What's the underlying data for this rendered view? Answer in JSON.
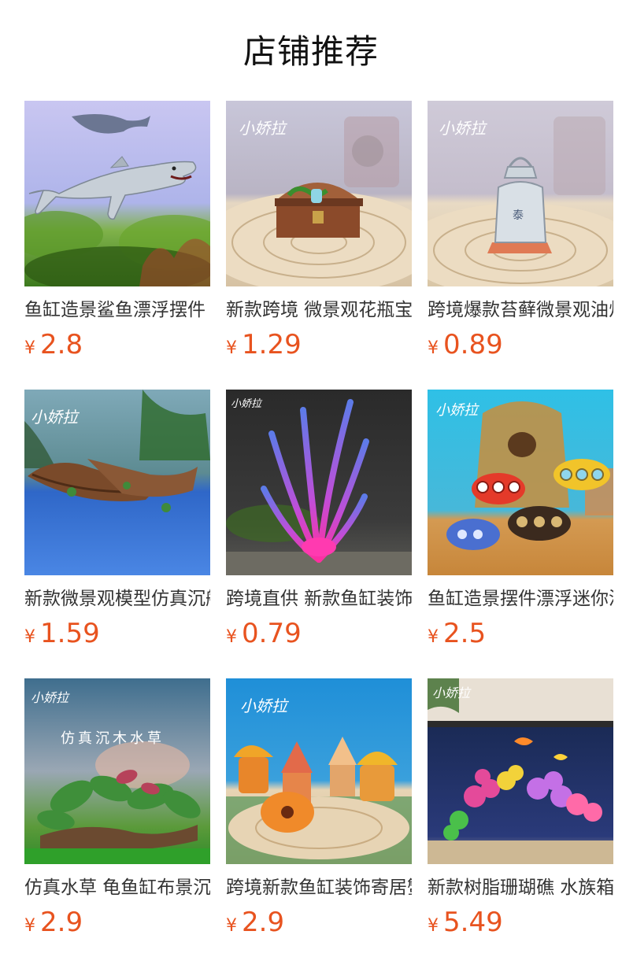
{
  "page": {
    "title": "店铺推荐"
  },
  "products": [
    {
      "name": "鱼缸造景鲨鱼漂浮摆件",
      "currency": "¥",
      "price": "2.8",
      "image_icon": "shark-figurine-image"
    },
    {
      "name": "新款跨境 微景观花瓶宝箱",
      "currency": "¥",
      "price": "1.29",
      "image_icon": "treasure-chest-image",
      "watermark": "小娇拉"
    },
    {
      "name": "跨境爆款苔藓微景观油灯",
      "currency": "¥",
      "price": "0.89",
      "image_icon": "lantern-image",
      "watermark": "小娇拉"
    },
    {
      "name": "新款微景观模型仿真沉船",
      "currency": "¥",
      "price": "1.59",
      "image_icon": "shipwreck-image",
      "watermark": "小娇拉"
    },
    {
      "name": "跨境直供 新款鱼缸装饰水草",
      "currency": "¥",
      "price": "0.79",
      "image_icon": "seaweed-plant-image",
      "watermark": "小娇拉"
    },
    {
      "name": "鱼缸造景摆件漂浮迷你潜艇",
      "currency": "¥",
      "price": "2.5",
      "image_icon": "submarine-image",
      "watermark": "小娇拉"
    },
    {
      "name": "仿真水草 龟鱼缸布景沉木",
      "currency": "¥",
      "price": "2.9",
      "image_icon": "driftwood-plant-image",
      "watermark": "小娇拉",
      "overlay_text": "仿真沉木水草"
    },
    {
      "name": "跨境新款鱼缸装饰寄居蟹屋",
      "currency": "¥",
      "price": "2.9",
      "image_icon": "mushroom-houses-image",
      "watermark": "小娇拉"
    },
    {
      "name": "新款树脂珊瑚礁 水族箱装饰",
      "currency": "¥",
      "price": "5.49",
      "image_icon": "coral-reef-image",
      "watermark": "小娇拉"
    }
  ]
}
